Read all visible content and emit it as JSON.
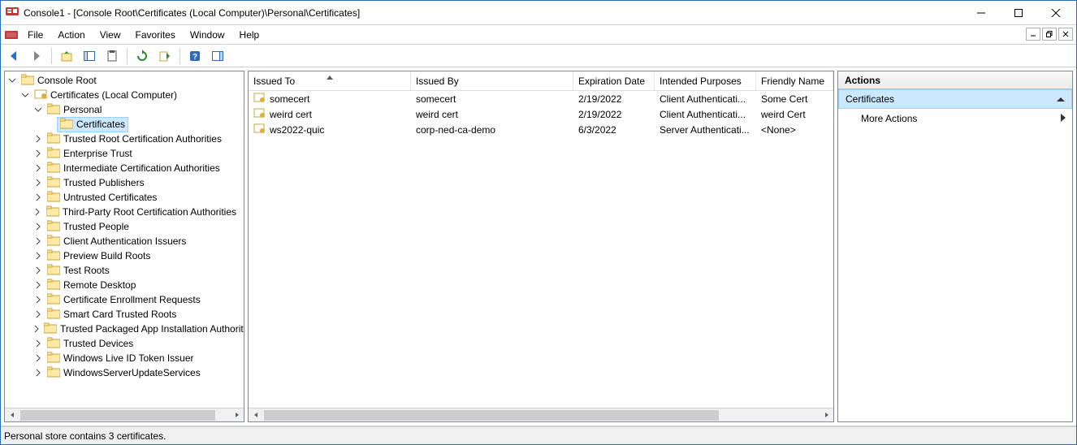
{
  "window": {
    "title": "Console1 - [Console Root\\Certificates (Local Computer)\\Personal\\Certificates]"
  },
  "menu": [
    "File",
    "Action",
    "View",
    "Favorites",
    "Window",
    "Help"
  ],
  "tree": {
    "root": "Console Root",
    "certificates_node": "Certificates (Local Computer)",
    "personal": "Personal",
    "personal_certs": "Certificates",
    "siblings": [
      "Trusted Root Certification Authorities",
      "Enterprise Trust",
      "Intermediate Certification Authorities",
      "Trusted Publishers",
      "Untrusted Certificates",
      "Third-Party Root Certification Authorities",
      "Trusted People",
      "Client Authentication Issuers",
      "Preview Build Roots",
      "Test Roots",
      "Remote Desktop",
      "Certificate Enrollment Requests",
      "Smart Card Trusted Roots",
      "Trusted Packaged App Installation Authorit",
      "Trusted Devices",
      "Windows Live ID Token Issuer",
      "WindowsServerUpdateServices"
    ]
  },
  "columns": {
    "issued_to": "Issued To",
    "issued_by": "Issued By",
    "expiration": "Expiration Date",
    "purposes": "Intended Purposes",
    "friendly": "Friendly Name"
  },
  "rows": [
    {
      "issued_to": "somecert",
      "issued_by": "somecert",
      "exp": "2/19/2022",
      "purp": "Client Authenticati...",
      "friendly": "Some Cert"
    },
    {
      "issued_to": "weird cert",
      "issued_by": "weird cert",
      "exp": "2/19/2022",
      "purp": "Client Authenticati...",
      "friendly": "weird Cert"
    },
    {
      "issued_to": "ws2022-quic",
      "issued_by": "corp-ned-ca-demo",
      "exp": "6/3/2022",
      "purp": "Server Authenticati...",
      "friendly": "<None>"
    }
  ],
  "actions": {
    "header": "Actions",
    "group": "Certificates",
    "more": "More Actions"
  },
  "status": "Personal store contains 3 certificates."
}
